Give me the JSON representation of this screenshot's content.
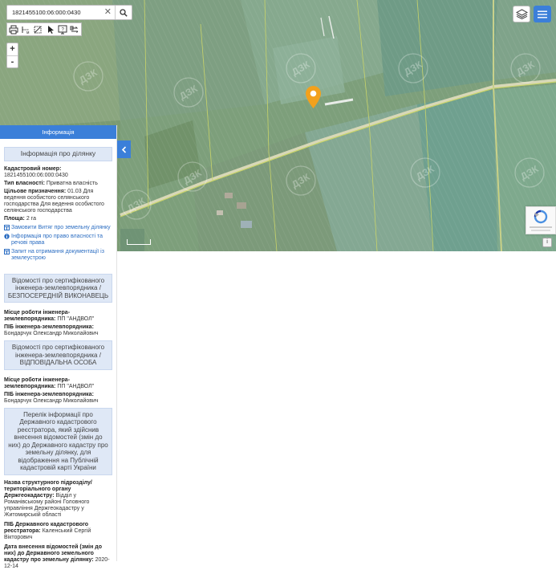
{
  "search": {
    "value": "1821455100:06:000:0430"
  },
  "map": {
    "watermark": "ДЗК"
  },
  "panel": {
    "header": "Інформація",
    "parcel": {
      "title": "Інформація про ділянку",
      "cadastral_label": "Кадастровий номер:",
      "cadastral_value": "1821455100:06:000:0430",
      "ownership_label": "Тип власності:",
      "ownership_value": "Приватна власність",
      "purpose_label": "Цільове призначення:",
      "purpose_value": "01.03 Для ведення особистого селянського господарства Для ведення особистого селянського господарства",
      "area_label": "Площа:",
      "area_value": "2 га",
      "links": [
        "Замовити Витяг про земельну ділянку",
        "Інформація про право власності та речові права",
        "Запит на отримання документації із землеустрою"
      ]
    },
    "executor": {
      "title": "Відомості про сертифікованого інженера-землевпорядника / БЕЗПОСЕРЕДНІЙ ВИКОНАВЕЦЬ",
      "workplace_label": "Місце роботи інженера-землевпорядника:",
      "workplace_value": "ПП \"АНДВОЛ\"",
      "name_label": "ПІБ інженера-землевпорядника:",
      "name_value": "Бондарчук Олександр Миколайович"
    },
    "responsible": {
      "title": "Відомості про сертифікованого інженера-землевпорядника / ВІДПОВІДАЛЬНА ОСОБА",
      "workplace_label": "Місце роботи інженера-землевпорядника:",
      "workplace_value": "ПП \"АНДВОЛ\"",
      "name_label": "ПІБ інженера-землевпорядника:",
      "name_value": "Бондарчук Олександр Миколайович"
    },
    "registrar": {
      "title": "Перелік інформації про Державного кадастрового реєстратора, який здійснив внесення відомостей (змін до них) до Державного кадастру про земельну ділянку, для відображення на Публічній кадастровій карті України",
      "unit_label": "Назва структурного підрозділу/ територіального органу Держгеокадастру:",
      "unit_value": "Відділ у Романівському районі Головного управління Держгеокадастру у Житомирській області",
      "name_label": "ПІБ Державного кадастрового реєстратора:",
      "name_value": "Каленський Сергій Вікторович",
      "date_label": "Дата внесення відомостей (змін до них) до Державного земельного кадастру про земельну ділянку:",
      "date_value": "2020-12-14"
    }
  },
  "colors": {
    "accent": "#3b7fd9",
    "marker": "#f2a11c",
    "section_bg": "#dfe8f6"
  }
}
